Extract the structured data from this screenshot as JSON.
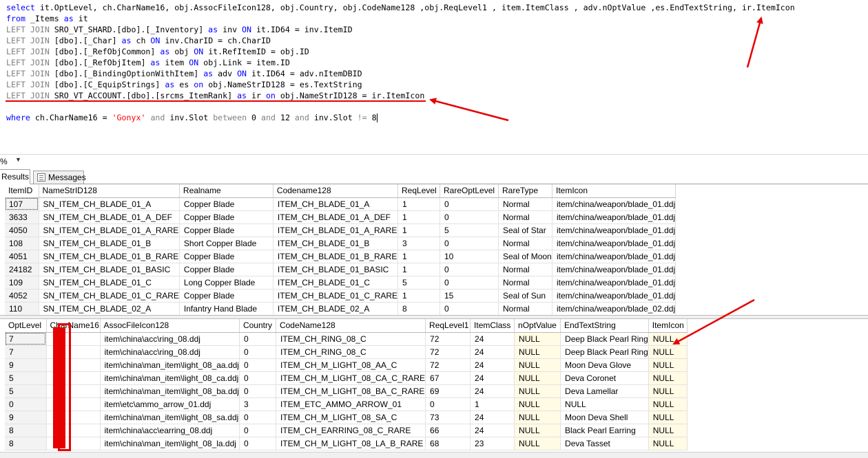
{
  "editor": {
    "line1": "select it.OptLevel, ch.CharName16, obj.AssocFileIcon128, obj.Country, obj.CodeName128 ,obj.ReqLevel1 , item.ItemClass , adv.nOptValue ,es.EndTextString, ir.ItemIcon",
    "line2": {
      "kw_from": "from",
      "table": " _Items ",
      "kw_as": "as",
      "alias": " it"
    },
    "joins": [
      {
        "kw": "LEFT JOIN",
        "rest": " SRO_VT_SHARD.[dbo].[_Inventory] ",
        "as": "as",
        "tail": " inv ",
        "on": "ON",
        "cond": " it.ID64 = inv.ItemID"
      },
      {
        "kw": "LEFT JOIN",
        "rest": " [dbo].[_Char] ",
        "as": "as",
        "tail": " ch ",
        "on": "ON",
        "cond": " inv.CharID = ch.CharID"
      },
      {
        "kw": "LEFT JOIN",
        "rest": " [dbo].[_RefObjCommon] ",
        "as": "as",
        "tail": " obj ",
        "on": "ON",
        "cond": " it.RefItemID = obj.ID"
      },
      {
        "kw": "LEFT JOIN",
        "rest": " [dbo].[_RefObjItem] ",
        "as": "as",
        "tail": " item ",
        "on": "ON",
        "cond": " obj.Link = item.ID"
      },
      {
        "kw": "LEFT JOIN",
        "rest": " [dbo].[_BindingOptionWithItem] ",
        "as": "as",
        "tail": " adv ",
        "on": "ON",
        "cond": " it.ID64 = adv.nItemDBID"
      },
      {
        "kw": "LEFT JOIN",
        "rest": " [dbo].[C_EquipStrings] ",
        "as": "as",
        "tail": " es ",
        "on": "on",
        "cond": " obj.NameStrID128 = es.TextString"
      },
      {
        "kw": "LEFT JOIN",
        "rest": " SRO_VT_ACCOUNT.[dbo].[srcms_ItemRank] ",
        "as": "as",
        "tail": " ir ",
        "on": "on",
        "cond": " obj.NameStrID128 = ir.ItemIcon"
      }
    ],
    "where": {
      "kw_where": "where",
      "a": " ch.CharName16 = ",
      "str": "'Gonyx'",
      "kw_and1": "and",
      "b": " inv.Slot ",
      "kw_between": "between",
      "n0": " 0 ",
      "kw_and2": "and",
      "n12": " 12 ",
      "kw_and3": "and",
      "c": " inv.Slot ",
      "neq": "!=",
      "n8": " 8"
    }
  },
  "zoom": {
    "value": "%"
  },
  "tabs": {
    "results": "Results",
    "messages": "Messages"
  },
  "grid1": {
    "columns": [
      "ItemID",
      "NameStrID128",
      "Realname",
      "Codename128",
      "ReqLevel",
      "RareOptLevel",
      "RareType",
      "ItemIcon"
    ],
    "rows": [
      [
        "107",
        "SN_ITEM_CH_BLADE_01_A",
        "Copper Blade",
        "ITEM_CH_BLADE_01_A",
        "1",
        "0",
        "Normal",
        "item/china/weapon/blade_01.ddj"
      ],
      [
        "3633",
        "SN_ITEM_CH_BLADE_01_A_DEF",
        "Copper Blade",
        "ITEM_CH_BLADE_01_A_DEF",
        "1",
        "0",
        "Normal",
        "item/china/weapon/blade_01.ddj"
      ],
      [
        "4050",
        "SN_ITEM_CH_BLADE_01_A_RARE",
        "Copper Blade",
        "ITEM_CH_BLADE_01_A_RARE",
        "1",
        "5",
        "Seal of Star",
        "item/china/weapon/blade_01.ddj"
      ],
      [
        "108",
        "SN_ITEM_CH_BLADE_01_B",
        "Short Copper Blade",
        "ITEM_CH_BLADE_01_B",
        "3",
        "0",
        "Normal",
        "item/china/weapon/blade_01.ddj"
      ],
      [
        "4051",
        "SN_ITEM_CH_BLADE_01_B_RARE",
        "Copper Blade",
        "ITEM_CH_BLADE_01_B_RARE",
        "1",
        "10",
        "Seal of Moon",
        "item/china/weapon/blade_01.ddj"
      ],
      [
        "24182",
        "SN_ITEM_CH_BLADE_01_BASIC",
        "Copper Blade",
        "ITEM_CH_BLADE_01_BASIC",
        "1",
        "0",
        "Normal",
        "item/china/weapon/blade_01.ddj"
      ],
      [
        "109",
        "SN_ITEM_CH_BLADE_01_C",
        "Long Copper Blade",
        "ITEM_CH_BLADE_01_C",
        "5",
        "0",
        "Normal",
        "item/china/weapon/blade_01.ddj"
      ],
      [
        "4052",
        "SN_ITEM_CH_BLADE_01_C_RARE",
        "Copper Blade",
        "ITEM_CH_BLADE_01_C_RARE",
        "1",
        "15",
        "Seal of Sun",
        "item/china/weapon/blade_01.ddj"
      ],
      [
        "110",
        "SN_ITEM_CH_BLADE_02_A",
        "Infantry Hand Blade",
        "ITEM_CH_BLADE_02_A",
        "8",
        "0",
        "Normal",
        "item/china/weapon/blade_02.ddj"
      ]
    ]
  },
  "grid2": {
    "columns": [
      "OptLevel",
      "CharName16",
      "AssocFileIcon128",
      "Country",
      "CodeName128",
      "ReqLevel1",
      "ItemClass",
      "nOptValue",
      "EndTextString",
      "ItemIcon"
    ],
    "rows": [
      [
        "7",
        "",
        "item\\china\\acc\\ring_08.ddj",
        "0",
        "ITEM_CH_RING_08_C",
        "72",
        "24",
        "NULL",
        "Deep Black Pearl Ring",
        "NULL"
      ],
      [
        "7",
        "",
        "item\\china\\acc\\ring_08.ddj",
        "0",
        "ITEM_CH_RING_08_C",
        "72",
        "24",
        "NULL",
        "Deep Black Pearl Ring",
        "NULL"
      ],
      [
        "9",
        "",
        "item\\china\\man_item\\light_08_aa.ddj",
        "0",
        "ITEM_CH_M_LIGHT_08_AA_C",
        "72",
        "24",
        "NULL",
        "Moon Deva Glove",
        "NULL"
      ],
      [
        "5",
        "",
        "item\\china\\man_item\\light_08_ca.ddj",
        "0",
        "ITEM_CH_M_LIGHT_08_CA_C_RARE",
        "67",
        "24",
        "NULL",
        "Deva Coronet",
        "NULL"
      ],
      [
        "5",
        "",
        "item\\china\\man_item\\light_08_ba.ddj",
        "0",
        "ITEM_CH_M_LIGHT_08_BA_C_RARE",
        "69",
        "24",
        "NULL",
        "Deva Lamellar",
        "NULL"
      ],
      [
        "0",
        "",
        "item\\etc\\ammo_arrow_01.ddj",
        "3",
        "ITEM_ETC_AMMO_ARROW_01",
        "0",
        "1",
        "NULL",
        "NULL",
        "NULL"
      ],
      [
        "9",
        "",
        "item\\china\\man_item\\light_08_sa.ddj",
        "0",
        "ITEM_CH_M_LIGHT_08_SA_C",
        "73",
        "24",
        "NULL",
        "Moon Deva Shell",
        "NULL"
      ],
      [
        "8",
        "",
        "item\\china\\acc\\earring_08.ddj",
        "0",
        "ITEM_CH_EARRING_08_C_RARE",
        "66",
        "24",
        "NULL",
        "Black Pearl Earring",
        "NULL"
      ],
      [
        "8",
        "",
        "item\\china\\man_item\\light_08_la.ddj",
        "0",
        "ITEM_CH_M_LIGHT_08_LA_B_RARE",
        "68",
        "23",
        "NULL",
        "Deva Tasset",
        "NULL"
      ]
    ]
  },
  "colors": {
    "keyword": "#0000ff",
    "comment_gray": "#808080",
    "function_magenta": "#ff00ff",
    "string_red": "#ff0000",
    "annotation_red": "#e60000",
    "null_cell": "#fffbe5"
  }
}
